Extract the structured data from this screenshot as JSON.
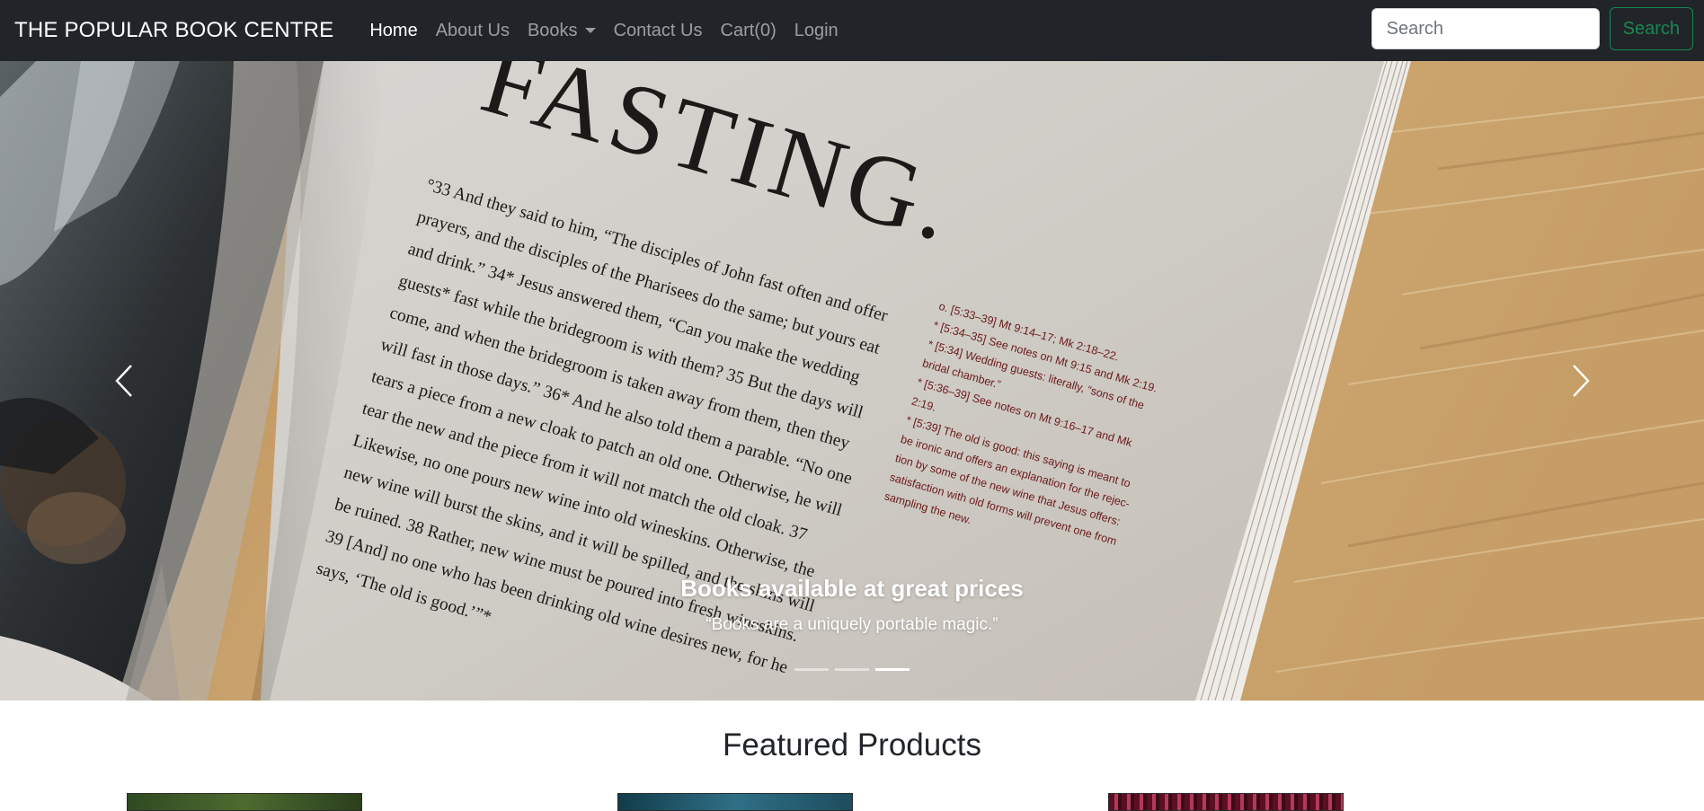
{
  "brand": "THE POPULAR BOOK CENTRE",
  "nav": {
    "home": "Home",
    "about": "About Us",
    "books": "Books",
    "contact": "Contact Us",
    "cart": "Cart(0)",
    "login": "Login"
  },
  "search": {
    "placeholder": "Search",
    "button": "Search"
  },
  "carousel": {
    "caption_title": "Books available at great prices",
    "caption_text": "“Books are a uniquely portable magic.”",
    "slide_count": 3,
    "active_index": 2,
    "page_heading": "FASTING.",
    "body_text": [
      "°33 And they said to him, “The disciples of John fast often and offer",
      "prayers, and the disciples of the Pharisees do the same; but yours eat",
      "and drink.” 34* Jesus answered them, “Can you make the wedding",
      "guests* fast while the bridegroom is with them? 35 But the days will",
      "come, and when the bridegroom is taken away from them, then they",
      "will fast in those days.” 36* And he also told them a parable. “No one",
      "tears a piece from a new cloak to patch an old one. Otherwise, he will",
      "tear the new and the piece from it will not match the old cloak. 37",
      "Likewise, no one pours new wine into old wineskins. Otherwise, the",
      "new wine will burst the skins, and it will be spilled, and the skins will",
      "be ruined. 38 Rather, new wine must be poured into fresh wineskins.",
      "39 [And] no one who has been drinking old wine desires new, for he",
      "says, ‘The old is good.’”*"
    ],
    "notes_text": [
      "o. [5:33–39] Mt 9:14–17; Mk 2:18–22.",
      "* [5:34–35] See notes on Mt 9:15 and Mk 2:19.",
      "* [5:34] Wedding guests: literally, “sons of the",
      "bridal chamber.”",
      "* [5:36–39] See notes on Mt 9:16–17 and Mk",
      "2:19.",
      "* [5:39] The old is good: this saying is meant to",
      "be ironic and offers an explanation for the rejec-",
      "tion by some of the new wine that Jesus offers:",
      "satisfaction with old forms will prevent one from",
      "sampling the new."
    ]
  },
  "featured": {
    "title": "Featured Products"
  },
  "colors": {
    "navbar_bg": "#212529",
    "search_accent": "#198754",
    "wood": "#c9a26c"
  },
  "icons": {
    "prev": "chevron-left-icon",
    "next": "chevron-right-icon",
    "dropdown": "caret-down-icon"
  }
}
